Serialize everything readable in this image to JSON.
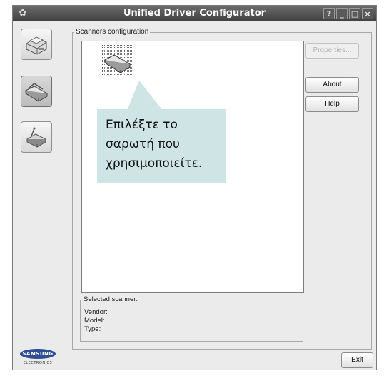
{
  "window": {
    "title": "Unified Driver Configurator",
    "title_icon": "gear-icon",
    "titlebar_buttons": [
      "?",
      "_",
      "□",
      "×"
    ]
  },
  "sidebar": {
    "items": [
      {
        "name": "printers",
        "icon": "printer-icon",
        "active": false
      },
      {
        "name": "scanners",
        "icon": "scanner-icon",
        "active": true
      },
      {
        "name": "ports",
        "icon": "port-icon",
        "active": false
      }
    ]
  },
  "scanners_group": {
    "label": "Scanners configuration"
  },
  "callout": {
    "lines": [
      "Επιλέξτε το",
      "σαρωτή που",
      "χρησιμοποιείτε."
    ]
  },
  "buttons": {
    "properties": "Properties...",
    "about": "About",
    "help": "Help",
    "exit": "Exit"
  },
  "selected_scanner": {
    "label": "Selected scanner:",
    "vendor": "Vendor:",
    "model": "Model:",
    "type": "Type:"
  },
  "logo": {
    "text": "SAMSUNG",
    "sub": "ELECTRONICS"
  },
  "colors": {
    "callout_bg": "#cfe4e4",
    "titlebar": "#4a4a4a",
    "logo": "#2d4d94"
  }
}
